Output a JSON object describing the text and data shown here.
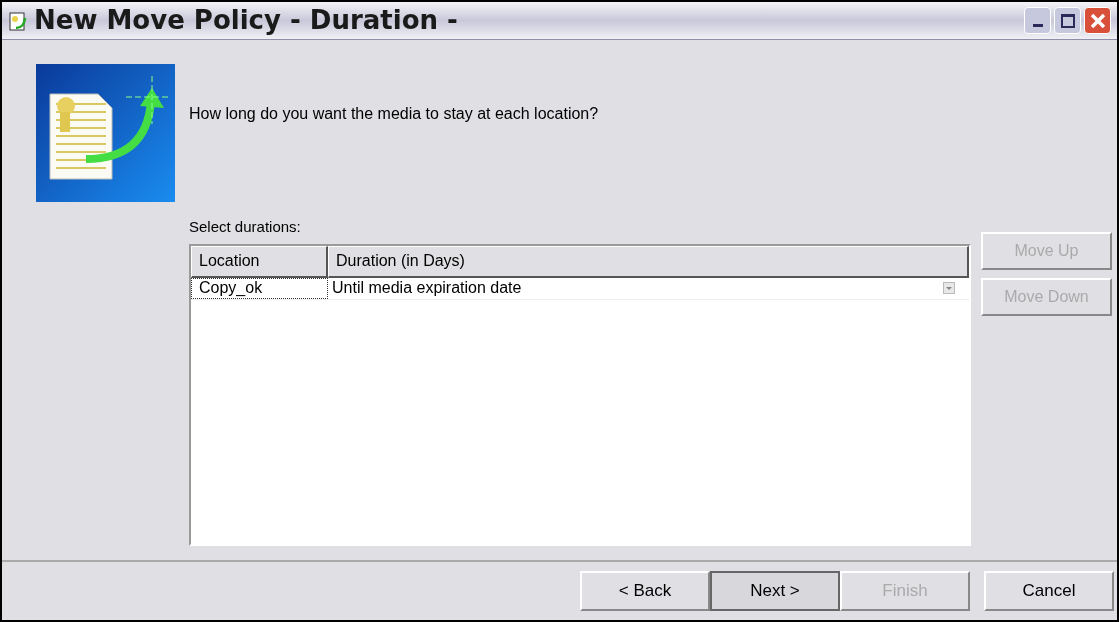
{
  "window": {
    "title": "New Move Policy - Duration -"
  },
  "prompt": "How long do you want the media to stay at each location?",
  "table": {
    "label": "Select durations:",
    "columns": [
      "Location",
      "Duration (in Days)"
    ],
    "rows": [
      {
        "location": "Copy_ok",
        "duration": "Until media expiration date",
        "focused": true
      }
    ]
  },
  "side_buttons": [
    {
      "label": "Move Up",
      "disabled": true
    },
    {
      "label": "Move Down",
      "disabled": true
    }
  ],
  "buttons": [
    {
      "label": "< Back",
      "disabled": false,
      "pressed": false
    },
    {
      "label": "Next >",
      "disabled": false,
      "pressed": true
    },
    {
      "label": "Finish",
      "disabled": true,
      "pressed": false
    },
    {
      "label": "Cancel",
      "disabled": false,
      "pressed": false
    }
  ]
}
